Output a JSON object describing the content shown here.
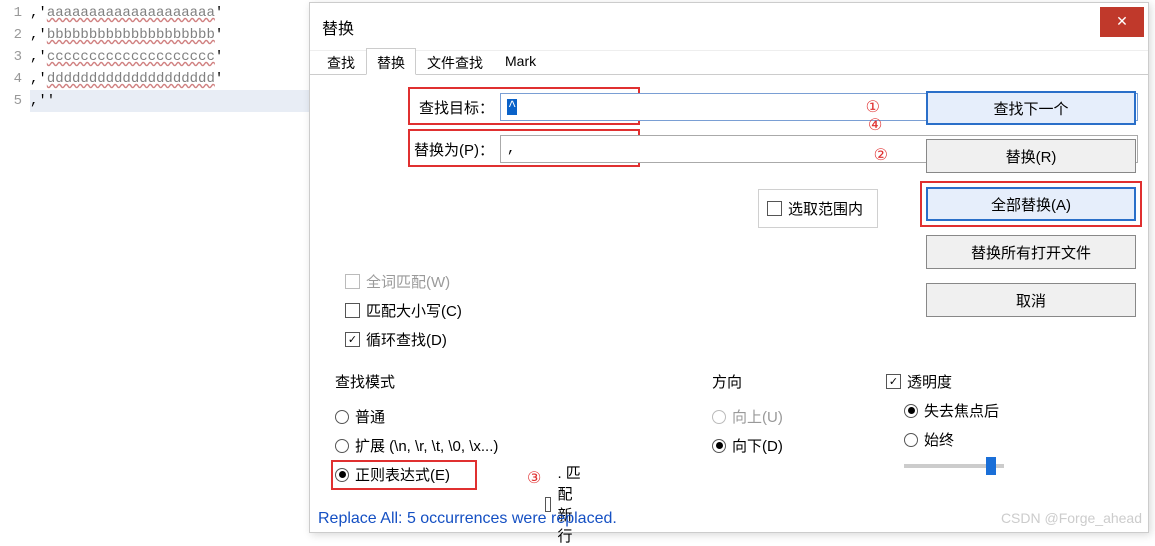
{
  "editor": {
    "lines": [
      {
        "num": "1",
        "prefix": ",'",
        "word": "aaaaaaaaaaaaaaaaaaaa",
        "suffix": "'"
      },
      {
        "num": "2",
        "prefix": ",'",
        "word": "bbbbbbbbbbbbbbbbbbbb",
        "suffix": "'"
      },
      {
        "num": "3",
        "prefix": ",'",
        "word": "cccccccccccccccccccc",
        "suffix": "'"
      },
      {
        "num": "4",
        "prefix": ",'",
        "word": "dddddddddddddddddddd",
        "suffix": "'"
      },
      {
        "num": "5",
        "prefix": ",''",
        "word": "",
        "suffix": ""
      }
    ]
  },
  "dialog": {
    "title": "替换",
    "tabs": [
      "查找",
      "替换",
      "文件查找",
      "Mark"
    ],
    "active_tab": 1,
    "find_label": "查找目标：",
    "find_value": "^",
    "replace_label": "替换为(P)：",
    "replace_value": ",",
    "in_selection": "选取范围内",
    "buttons": {
      "find_next": "查找下一个",
      "replace": "替换(R)",
      "replace_all": "全部替换(A)",
      "replace_all_open": "替换所有打开文件",
      "cancel": "取消"
    },
    "options": {
      "whole_word": "全词匹配(W)",
      "match_case": "匹配大小写(C)",
      "wrap": "循环查找(D)"
    },
    "mode": {
      "label": "查找模式",
      "normal": "普通",
      "extended": "扩展 (\\n, \\r, \\t, \\0, \\x...)",
      "regex": "正则表达式(E)",
      "dot_newline": ". 匹配新行"
    },
    "direction": {
      "label": "方向",
      "up": "向上(U)",
      "down": "向下(D)"
    },
    "transparency": {
      "label": "透明度",
      "on_lose_focus": "失去焦点后",
      "always": "始终"
    },
    "annotations": {
      "a1": "①",
      "a2": "②",
      "a3": "③",
      "a4": "④"
    },
    "status": "Replace All: 5 occurrences were replaced.",
    "watermark": "CSDN @Forge_ahead"
  }
}
